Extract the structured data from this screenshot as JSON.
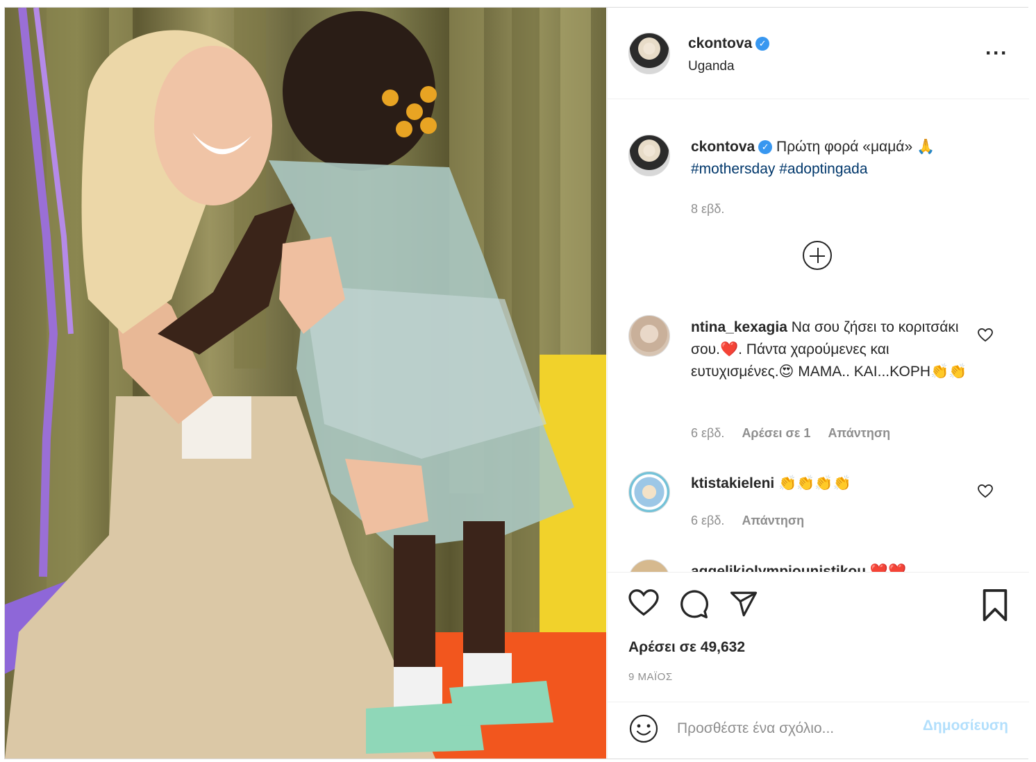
{
  "post": {
    "image_alt": "photo"
  },
  "header": {
    "username": "ckontova",
    "location": "Uganda",
    "more_icon": "more-options-icon"
  },
  "caption": {
    "username": "ckontova",
    "text": "Πρώτη φορά «μαμά» 🙏",
    "hashtags": [
      "#mothersday",
      "#adoptingada"
    ],
    "time": "8 εβδ."
  },
  "comments": [
    {
      "username": "ntina_kexagia",
      "text": "Να σου ζήσει το κοριτσάκι σου.❤️. Πάντα χαρούμενες και ευτυχισμένες.😍 ΜΑΜΑ.. ΚΑΙ...ΚΟΡΗ👏👏",
      "time": "6 εβδ.",
      "likes": "Αρέσει σε 1",
      "reply": "Απάντηση"
    },
    {
      "username": "ktistakieleni",
      "text": "👏👏👏👏",
      "time": "6 εβδ.",
      "reply": "Απάντηση"
    },
    {
      "username": "aggelikiolympiounistikou",
      "text": "❤️❤️"
    }
  ],
  "actions": {
    "like_icon": "heart-icon",
    "comment_icon": "comment-icon",
    "share_icon": "paper-plane-icon",
    "save_icon": "bookmark-icon",
    "likes_text": "Αρέσει σε 49,632",
    "date": "9 ΜΑΪΟΣ"
  },
  "composer": {
    "placeholder": "Προσθέστε ένα σχόλιο...",
    "post_label": "Δημοσίευση"
  }
}
